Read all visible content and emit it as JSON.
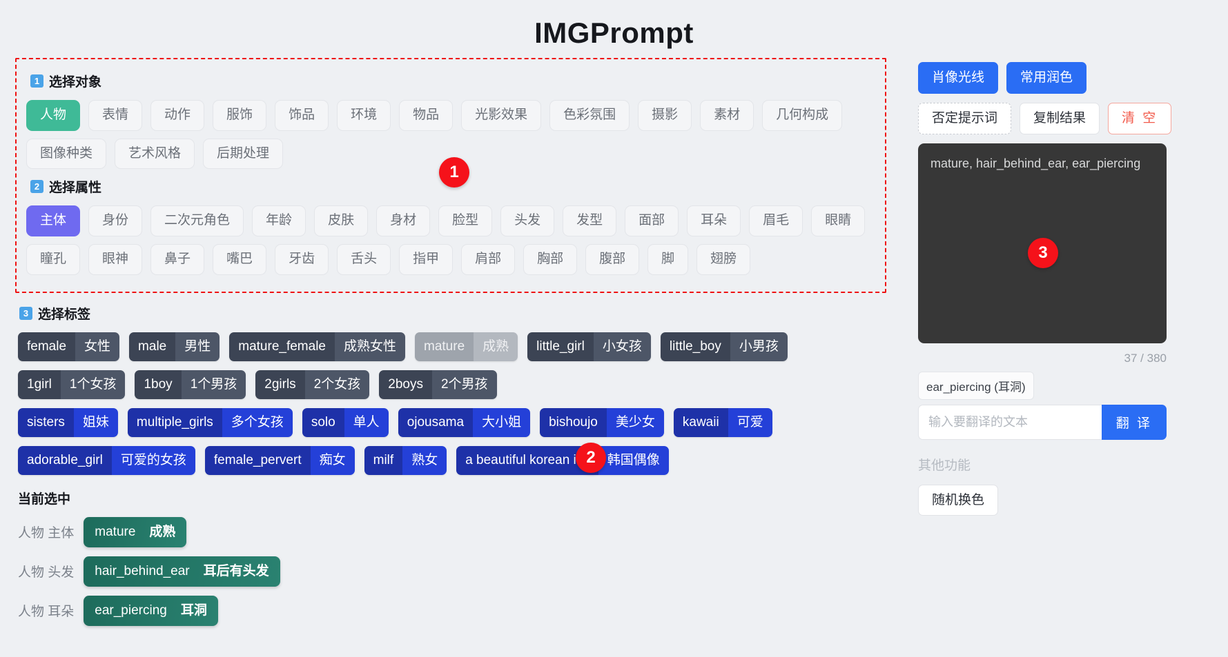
{
  "app": {
    "title": "IMGPrompt"
  },
  "sections": {
    "object": {
      "num": "1",
      "label": "选择对象"
    },
    "attribute": {
      "num": "2",
      "label": "选择属性"
    },
    "tags": {
      "num": "3",
      "label": "选择标签"
    },
    "current": {
      "label": "当前选中"
    }
  },
  "badges": {
    "one": "1",
    "two": "2",
    "three": "3"
  },
  "categories": [
    {
      "label": "人物",
      "state": "active-green"
    },
    {
      "label": "表情",
      "state": ""
    },
    {
      "label": "动作",
      "state": ""
    },
    {
      "label": "服饰",
      "state": ""
    },
    {
      "label": "饰品",
      "state": ""
    },
    {
      "label": "环境",
      "state": ""
    },
    {
      "label": "物品",
      "state": ""
    },
    {
      "label": "光影效果",
      "state": ""
    },
    {
      "label": "色彩氛围",
      "state": ""
    },
    {
      "label": "摄影",
      "state": ""
    },
    {
      "label": "素材",
      "state": ""
    },
    {
      "label": "几何构成",
      "state": ""
    },
    {
      "label": "图像种类",
      "state": ""
    },
    {
      "label": "艺术风格",
      "state": ""
    },
    {
      "label": "后期处理",
      "state": ""
    }
  ],
  "attributes": [
    {
      "label": "主体",
      "state": "active-purple"
    },
    {
      "label": "身份",
      "state": ""
    },
    {
      "label": "二次元角色",
      "state": ""
    },
    {
      "label": "年龄",
      "state": ""
    },
    {
      "label": "皮肤",
      "state": ""
    },
    {
      "label": "身材",
      "state": ""
    },
    {
      "label": "脸型",
      "state": ""
    },
    {
      "label": "头发",
      "state": ""
    },
    {
      "label": "发型",
      "state": ""
    },
    {
      "label": "面部",
      "state": ""
    },
    {
      "label": "耳朵",
      "state": ""
    },
    {
      "label": "眉毛",
      "state": ""
    },
    {
      "label": "眼睛",
      "state": ""
    },
    {
      "label": "瞳孔",
      "state": ""
    },
    {
      "label": "眼神",
      "state": ""
    },
    {
      "label": "鼻子",
      "state": ""
    },
    {
      "label": "嘴巴",
      "state": ""
    },
    {
      "label": "牙齿",
      "state": ""
    },
    {
      "label": "舌头",
      "state": ""
    },
    {
      "label": "指甲",
      "state": ""
    },
    {
      "label": "肩部",
      "state": ""
    },
    {
      "label": "胸部",
      "state": ""
    },
    {
      "label": "腹部",
      "state": ""
    },
    {
      "label": "脚",
      "state": ""
    },
    {
      "label": "翅膀",
      "state": ""
    }
  ],
  "tag_rows": [
    [
      {
        "en": "female",
        "cn": "女性",
        "style": "dark"
      },
      {
        "en": "male",
        "cn": "男性",
        "style": "dark"
      },
      {
        "en": "mature_female",
        "cn": "成熟女性",
        "style": "dark"
      },
      {
        "en": "mature",
        "cn": "成熟",
        "style": "muted"
      },
      {
        "en": "little_girl",
        "cn": "小女孩",
        "style": "dark"
      },
      {
        "en": "little_boy",
        "cn": "小男孩",
        "style": "dark"
      }
    ],
    [
      {
        "en": "1girl",
        "cn": "1个女孩",
        "style": "dark"
      },
      {
        "en": "1boy",
        "cn": "1个男孩",
        "style": "dark"
      },
      {
        "en": "2girls",
        "cn": "2个女孩",
        "style": "dark"
      },
      {
        "en": "2boys",
        "cn": "2个男孩",
        "style": "dark"
      }
    ],
    [
      {
        "en": "sisters",
        "cn": "姐妹",
        "style": "blue"
      },
      {
        "en": "multiple_girls",
        "cn": "多个女孩",
        "style": "blue"
      },
      {
        "en": "solo",
        "cn": "单人",
        "style": "blue"
      },
      {
        "en": "ojousama",
        "cn": "大小姐",
        "style": "blue"
      },
      {
        "en": "bishoujo",
        "cn": "美少女",
        "style": "blue"
      },
      {
        "en": "kawaii",
        "cn": "可爱",
        "style": "blue"
      }
    ],
    [
      {
        "en": "adorable_girl",
        "cn": "可爱的女孩",
        "style": "blue"
      },
      {
        "en": "female_pervert",
        "cn": "痴女",
        "style": "blue"
      },
      {
        "en": "milf",
        "cn": "熟女",
        "style": "blue"
      },
      {
        "en": "a beautiful korean i…",
        "cn": "韩国偶像",
        "style": "blue"
      }
    ]
  ],
  "selected": [
    {
      "path": "人物 主体",
      "en": "mature",
      "cn": "成熟"
    },
    {
      "path": "人物 头发",
      "en": "hair_behind_ear",
      "cn": "耳后有头发"
    },
    {
      "path": "人物 耳朵",
      "en": "ear_piercing",
      "cn": "耳洞"
    }
  ],
  "right_panel": {
    "buttons_row1": [
      {
        "label": "肖像光线",
        "style": "primary"
      },
      {
        "label": "常用润色",
        "style": "primary"
      }
    ],
    "buttons_row2": [
      {
        "label": "否定提示词",
        "style": "ghost-dotted"
      },
      {
        "label": "复制结果",
        "style": "ghost"
      },
      {
        "label": "清 空",
        "style": "danger"
      }
    ],
    "prompt_value": "mature, hair_behind_ear, ear_piercing",
    "counter": "37 / 380",
    "translate_chip": "ear_piercing (耳洞)",
    "translate_placeholder": "输入要翻译的文本",
    "translate_value": "",
    "translate_button": "翻 译",
    "other_label": "其他功能",
    "random_color_button": "随机换色"
  },
  "colors": {
    "accent_blue": "#2a6df4",
    "active_green": "#3fba97",
    "active_purple": "#6f6af0",
    "tag_dark": "#3c4454",
    "tag_blue": "#1e31a8",
    "selected_green": "#1d6b5b",
    "badge_red": "#f5121a",
    "danger_red": "#f25b4c",
    "dashed_red": "#ee1111"
  }
}
